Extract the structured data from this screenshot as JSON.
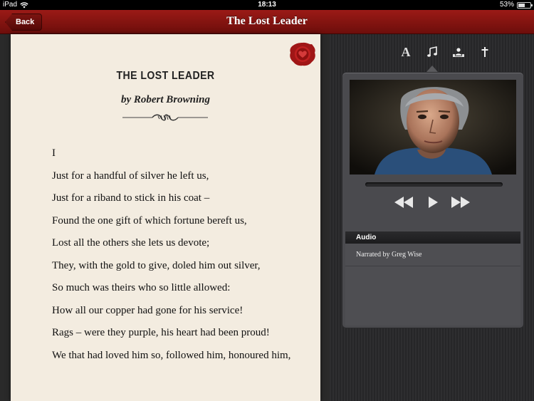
{
  "status": {
    "device": "iPad",
    "time": "18:13",
    "battery_percent": "53%"
  },
  "nav": {
    "back_label": "Back",
    "title": "The Lost Leader"
  },
  "poem": {
    "title": "THE LOST LEADER",
    "author": "by Robert Browning",
    "lines": [
      "I",
      "Just for a handful of silver he left us,",
      "Just for a riband to stick in his coat –",
      "Found the one gift of which fortune bereft us,",
      "Lost all the others she lets us devote;",
      "They, with the gold to give, doled him out silver,",
      "So much was theirs who so little allowed:",
      "How all our copper had gone for his service!",
      "Rags – were they purple, his heart had been proud!",
      "We that had loved him so, followed him, honoured him,"
    ]
  },
  "tabs": [
    {
      "name": "text",
      "icon": "letter-a-icon",
      "label": "A"
    },
    {
      "name": "audio",
      "icon": "music-note-icon"
    },
    {
      "name": "people",
      "icon": "people-icon"
    },
    {
      "name": "dagger",
      "icon": "dagger-icon"
    }
  ],
  "audio": {
    "header": "Audio",
    "items": [
      {
        "label": "Narrated by Greg Wise"
      }
    ],
    "progress": 0.0
  },
  "colors": {
    "nav": "#8a1714",
    "page": "#f3ece0",
    "pane": "#2c2c2e",
    "panel": "#4a4a4e"
  }
}
